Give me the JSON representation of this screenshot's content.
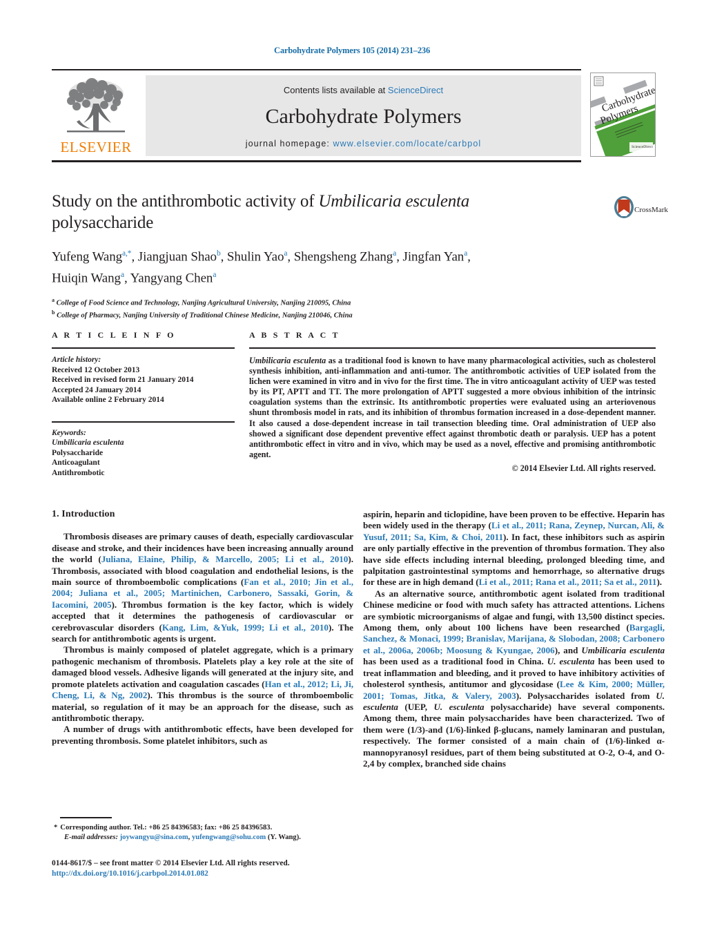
{
  "running_head": "Carbohydrate Polymers 105 (2014) 231–236",
  "masthead": {
    "publisher_logo_label": "ELSEVIER",
    "contents_prefix": "Contents lists available at ",
    "contents_link": "ScienceDirect",
    "journal_title": "Carbohydrate Polymers",
    "homepage_prefix": "journal homepage: ",
    "homepage_url": "www.elsevier.com/locate/carbpol",
    "cover_title_line1": "Carbohydrate",
    "cover_title_line2": "Polymers",
    "cover_badge": "ScienceDirect"
  },
  "crossmark": {
    "label": "CrossMark"
  },
  "article": {
    "title_part1": "Study on the antithrombotic activity of ",
    "title_italic": "Umbilicaria esculenta",
    "title_part2": "polysaccharide",
    "authors": [
      {
        "name": "Yufeng Wang",
        "sup": "a,*"
      },
      {
        "name": "Jiangjuan Shao",
        "sup": "b"
      },
      {
        "name": "Shulin Yao",
        "sup": "a"
      },
      {
        "name": "Shengsheng Zhang",
        "sup": "a"
      },
      {
        "name": "Jingfan Yan",
        "sup": "a"
      },
      {
        "name": "Huiqin Wang",
        "sup": "a"
      },
      {
        "name": "Yangyang Chen",
        "sup": "a"
      }
    ],
    "affiliations": [
      {
        "marker": "a",
        "text": "College of Food Science and Technology, Nanjing Agricultural University, Nanjing 210095, China"
      },
      {
        "marker": "b",
        "text": "College of Pharmacy, Nanjing University of Traditional Chinese Medicine, Nanjing 210046, China"
      }
    ]
  },
  "article_info": {
    "heading": "A R T I C L E    I N F O",
    "history_label": "Article history:",
    "history": [
      "Received 12 October 2013",
      "Received in revised form 21 January 2014",
      "Accepted 24 January 2014",
      "Available online 2 February 2014"
    ],
    "keywords_label": "Keywords:",
    "keywords": [
      "Umbilicaria esculenta",
      "Polysaccharide",
      "Anticoagulant",
      "Antithrombotic"
    ],
    "keywords_italic_index": 0
  },
  "abstract": {
    "heading": "A B S T R A C T",
    "lead_italic": "Umbilicaria esculenta",
    "text": " as a traditional food is known to have many pharmacological activities, such as cholesterol synthesis inhibition, anti-inflammation and anti-tumor. The antithrombotic activities of UEP isolated from the lichen were examined in vitro and in vivo for the first time. The in vitro anticoagulant activity of UEP was tested by its PT, APTT and TT. The more prolongation of APTT suggested a more obvious inhibition of the intrinsic coagulation systems than the extrinsic. Its antithrombotic properties were evaluated using an arteriovenous shunt thrombosis model in rats, and its inhibition of thrombus formation increased in a dose-dependent manner. It also caused a dose-dependent increase in tail transection bleeding time. Oral administration of UEP also showed a significant dose dependent preventive effect against thrombotic death or paralysis. UEP has a potent antithrombotic effect in vitro and in vivo, which may be used as a novel, effective and promising antithrombotic agent.",
    "copyright": "© 2014 Elsevier Ltd. All rights reserved."
  },
  "body": {
    "section_heading": "1.  Introduction",
    "left_paragraphs": [
      "Thrombosis diseases are primary causes of death, especially cardiovascular disease and stroke, and their incidences have been increasing annually around the world (§Juliana, Elaine, Philip, & Marcello, 2005; Li et al., 2010§). Thrombosis, associated with blood coagulation and endothelial lesions, is the main source of thromboembolic complications (§Fan et al., 2010; Jin et al., 2004; Juliana et al., 2005; Martinichen, Carbonero, Sassaki, Gorin, & Iacomini, 2005§). Thrombus formation is the key factor, which is widely accepted that it determines the pathogenesis of cardiovascular or cerebrovascular disorders (§Kang, Lim, &Yuk, 1999; Li et al., 2010§). The search for antithrombotic agents is urgent.",
      "Thrombus is mainly composed of platelet aggregate, which is a primary pathogenic mechanism of thrombosis. Platelets play a key role at the site of damaged blood vessels. Adhesive ligands will generated at the injury site, and promote platelets activation and coagulation cascades (§Han et al., 2012; Li, Ji, Cheng, Li, & Ng, 2002§). This thrombus is the source of thromboembolic material, so regulation of it may be an approach for the disease, such as antithrombotic therapy.",
      "A number of drugs with antithrombotic effects, have been developed for preventing thrombosis. Some platelet inhibitors, such as"
    ],
    "right_paragraphs": [
      "aspirin, heparin and ticlopidine, have been proven to be effective. Heparin has been widely used in the therapy (§Li et al., 2011; Rana, Zeynep, Nurcan, Ali, & Yusuf, 2011; Sa, Kim, & Choi, 2011§). In fact, these inhibitors such as aspirin are only partially effective in the prevention of thrombus formation. They also have side effects including internal bleeding, prolonged bleeding time, and palpitation gastrointestinal symptoms and hemorrhage, so alternative drugs for these are in high demand (§Li et al., 2011; Rana et al., 2011; Sa et al., 2011§).",
      "As an alternative source, antithrombotic agent isolated from traditional Chinese medicine or food with much safety has attracted attentions. Lichens are symbiotic microorganisms of algae and fungi, with 13,500 distinct species. Among them, only about 100 lichens have been researched (§Bargagli, Sanchez, & Monaci, 1999; Branislav, Marijana, & Slobodan, 2008; Carbonero et al., 2006a, 2006b; Moosung & Kyungae, 2006§), and #Umbilicaria esculenta# has been used as a traditional food in China. #U. esculenta# has been used to treat inflammation and bleeding, and it proved to have inhibitory activities of cholesterol synthesis, antitumor and glycosidase (§Lee & Kim, 2000; Müller, 2001; Tomas, Jitka, & Valery, 2003§). Polysaccharides isolated from #U. esculenta# (UEP, #U. esculenta# polysaccharide) have several components. Among them, three main polysaccharides have been characterized. Two of them were (1/3)-and (1/6)-linked β-glucans, namely laminaran and pustulan, respectively. The former consisted of a main chain of (1/6)-linked α-mannopyranosyl residues, part of them being substituted at O-2, O-4, and O-2,4 by complex, branched side chains"
    ]
  },
  "footnotes": {
    "corresponding": "Corresponding author. Tel.: +86 25 84396583; fax: +86 25 84396583.",
    "email_label": "E-mail addresses:",
    "emails": [
      "joywangyu@sina.com",
      "yufengwang@sohu.com"
    ],
    "email_attrib": "(Y. Wang).",
    "star": "*"
  },
  "colophon": {
    "line1": "0144-8617/$ – see front matter © 2014 Elsevier Ltd. All rights reserved.",
    "doi": "http://dx.doi.org/10.1016/j.carbpol.2014.01.082"
  },
  "colors": {
    "link": "#2b7ab5",
    "elsevier_orange": "#f07d00",
    "rule": "#231f20",
    "grey_box": "#e7e7e8",
    "cover_green": "#4fa03a"
  }
}
